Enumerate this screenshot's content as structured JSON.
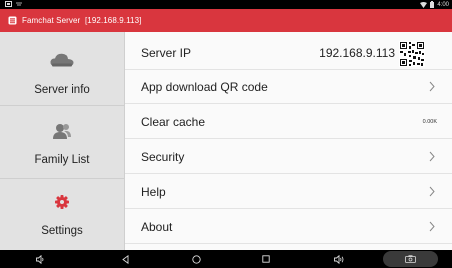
{
  "status_bar": {
    "time": "4:00",
    "icons": [
      "notification-icon",
      "cast-icon",
      "wifi-icon",
      "battery-icon"
    ]
  },
  "title_bar": {
    "title": "Famchat Server",
    "address": "[192.168.9.113]",
    "accent": "#d9363e"
  },
  "sidebar": {
    "items": [
      {
        "label": "Server info",
        "icon": "cloud-icon",
        "selected": true
      },
      {
        "label": "Family List",
        "icon": "people-icon",
        "selected": false
      },
      {
        "label": "Settings",
        "icon": "gear-icon",
        "selected": false
      }
    ]
  },
  "settings": {
    "rows": [
      {
        "label": "Server IP",
        "value": "192.168.9.113",
        "trailing": "qr-code-icon"
      },
      {
        "label": "App download QR code",
        "trailing": "chevron-right-icon"
      },
      {
        "label": "Clear cache",
        "value": "0.00K"
      },
      {
        "label": "Security",
        "trailing": "chevron-right-icon"
      },
      {
        "label": "Help",
        "trailing": "chevron-right-icon"
      },
      {
        "label": "About",
        "trailing": "chevron-right-icon"
      }
    ]
  },
  "nav_bar": {
    "buttons": [
      "volume-down-icon",
      "back-icon",
      "home-icon",
      "recents-icon",
      "volume-up-icon",
      "screenshot-icon"
    ]
  }
}
